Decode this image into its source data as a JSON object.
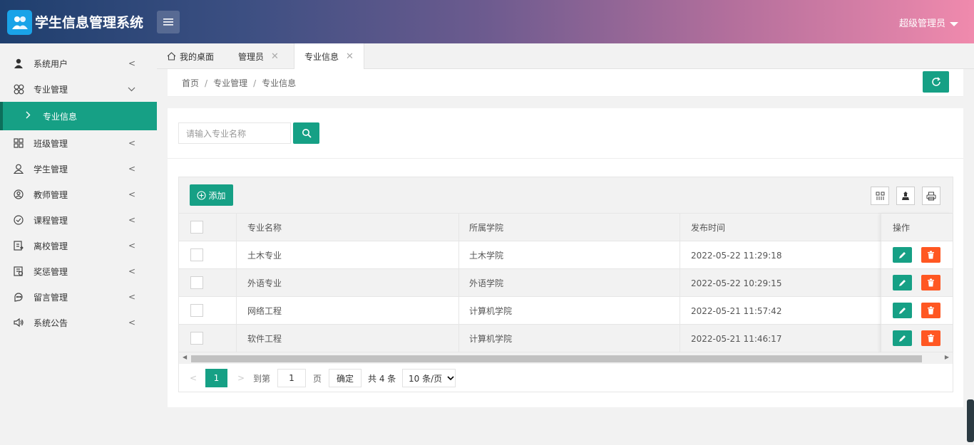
{
  "header": {
    "title": "学生信息管理系统",
    "user": "超级管理员"
  },
  "sidebar": {
    "items": [
      {
        "label": "系统用户",
        "icon": "user-icon"
      },
      {
        "label": "专业管理",
        "icon": "clover-icon",
        "expanded": true
      },
      {
        "label": "专业信息",
        "active": true
      },
      {
        "label": "班级管理",
        "icon": "grid-icon"
      },
      {
        "label": "学生管理",
        "icon": "users-icon"
      },
      {
        "label": "教师管理",
        "icon": "teacher-icon"
      },
      {
        "label": "课程管理",
        "icon": "check-circle-icon"
      },
      {
        "label": "离校管理",
        "icon": "leave-icon"
      },
      {
        "label": "奖惩管理",
        "icon": "award-icon"
      },
      {
        "label": "留言管理",
        "icon": "message-icon"
      },
      {
        "label": "系统公告",
        "icon": "speaker-icon"
      }
    ]
  },
  "tabs": [
    {
      "label": "我的桌面"
    },
    {
      "label": "管理员"
    },
    {
      "label": "专业信息"
    }
  ],
  "breadcrumb": [
    "首页",
    "专业管理",
    "专业信息"
  ],
  "search": {
    "placeholder": "请输入专业名称"
  },
  "toolbar": {
    "add_label": "添加"
  },
  "table": {
    "columns": [
      "专业名称",
      "所属学院",
      "发布时间",
      "操作"
    ],
    "rows": [
      {
        "name": "土木专业",
        "college": "土木学院",
        "time": "2022-05-22 11:29:18"
      },
      {
        "name": "外语专业",
        "college": "外语学院",
        "time": "2022-05-22 10:29:15"
      },
      {
        "name": "网络工程",
        "college": "计算机学院",
        "time": "2022-05-21 11:57:42"
      },
      {
        "name": "软件工程",
        "college": "计算机学院",
        "time": "2022-05-21 11:46:17"
      }
    ]
  },
  "pager": {
    "current": "1",
    "goto_label": "到第",
    "page_value": "1",
    "page_unit": "页",
    "confirm": "确定",
    "total": "共 4 条",
    "limit": "10 条/页"
  },
  "colors": {
    "accent": "#16a085",
    "danger": "#ff5722"
  }
}
